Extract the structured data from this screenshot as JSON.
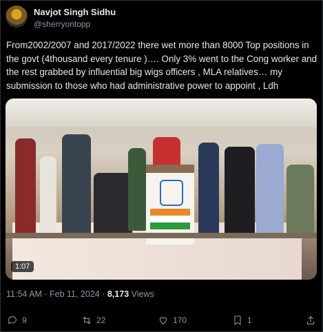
{
  "tweet": {
    "author_name": "Navjot Singh Sidhu",
    "author_handle": "@sherryontopp",
    "text": "From2002/2007 and 2017/2022 there wet more than 8000 Top positions in the govt (4thousand every tenure )…. Only 3% went to the Cong worker and the rest grabbed by influential big wigs officers , MLA relatives… my submission to those who had administrative power to appoint , Ldh",
    "video_duration": "1:07",
    "timestamp": "11:54 AM · Feb 11, 2024 · ",
    "views_count": "8,173",
    "views_label": " Views"
  },
  "actions": {
    "replies": "9",
    "retweets": "22",
    "likes": "170",
    "bookmarks": "1"
  },
  "icons": {
    "reply": "reply-icon",
    "retweet": "retweet-icon",
    "like": "heart-icon",
    "bookmark": "bookmark-icon",
    "share": "share-icon"
  },
  "colors": {
    "background": "#000000",
    "text": "#e7e9ea",
    "secondary": "#8b98a5"
  }
}
